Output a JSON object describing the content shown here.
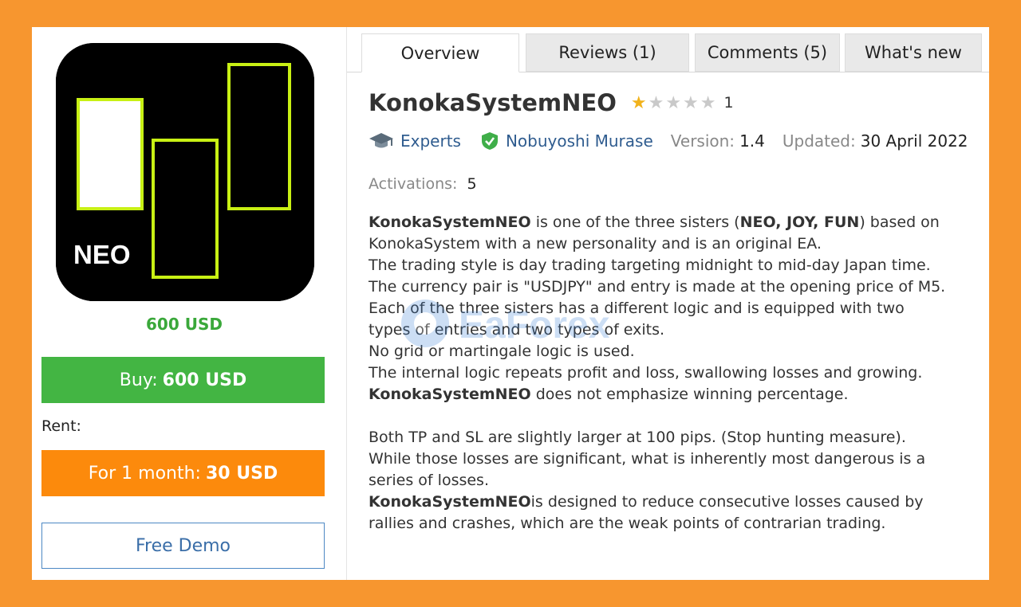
{
  "product": {
    "name": "KonokaSystemNEO",
    "image_label": "NEO",
    "price": "600 USD",
    "buy_label": "Buy:",
    "buy_price": "600 USD",
    "rent_label": "Rent:",
    "rent_option_label": "For 1 month:",
    "rent_option_price": "30 USD",
    "demo_label": "Free Demo"
  },
  "tabs": [
    "Overview",
    "Reviews (1)",
    "Comments (5)",
    "What's new"
  ],
  "rating": {
    "stars": 1,
    "max": 5,
    "count": "1"
  },
  "meta": {
    "category": "Experts",
    "author": "Nobuyoshi Murase",
    "version_label": "Version:",
    "version": "1.4",
    "updated_label": "Updated:",
    "updated": "30 April 2022",
    "activations_label": "Activations:",
    "activations": "5"
  },
  "description": {
    "p1_bold": "KonokaSystemNEO",
    "p1_a": " is one of the three sisters (",
    "p1_bold2": "NEO, JOY, FUN",
    "p1_b": ") based on",
    "l2": "KonokaSystem with a new personality and is an original EA.",
    "l3": "The trading style is day trading targeting midnight to mid-day Japan time.",
    "l4": "The currency pair is \"USDJPY\" and entry is made at the opening price of M5.",
    "l5": "Each of the three sisters has a different logic and is equipped with two",
    "l6": "types of entries and two types of exits.",
    "l7": "No grid or martingale logic is used.",
    "l8": "The internal logic repeats profit and loss, swallowing losses and growing.",
    "l9_bold": "KonokaSystemNEO",
    "l9": " does not emphasize winning percentage.",
    "l10": "Both TP and SL are slightly larger at 100 pips. (Stop hunting measure).",
    "l11": "While those losses are significant, what is inherently most dangerous is a",
    "l12": "series of losses.",
    "l13_bold": "KonokaSystemNEO",
    "l13": "is designed to reduce consecutive losses caused by",
    "l14": "rallies and crashes, which are the weak points of contrarian trading."
  },
  "watermark": "EaForex",
  "colors": {
    "background": "#f7962f",
    "buy": "#43b543",
    "rent": "#fc8a0c",
    "price": "#3aa83a",
    "link": "#2f5c8f",
    "neon": "#c8f014"
  }
}
